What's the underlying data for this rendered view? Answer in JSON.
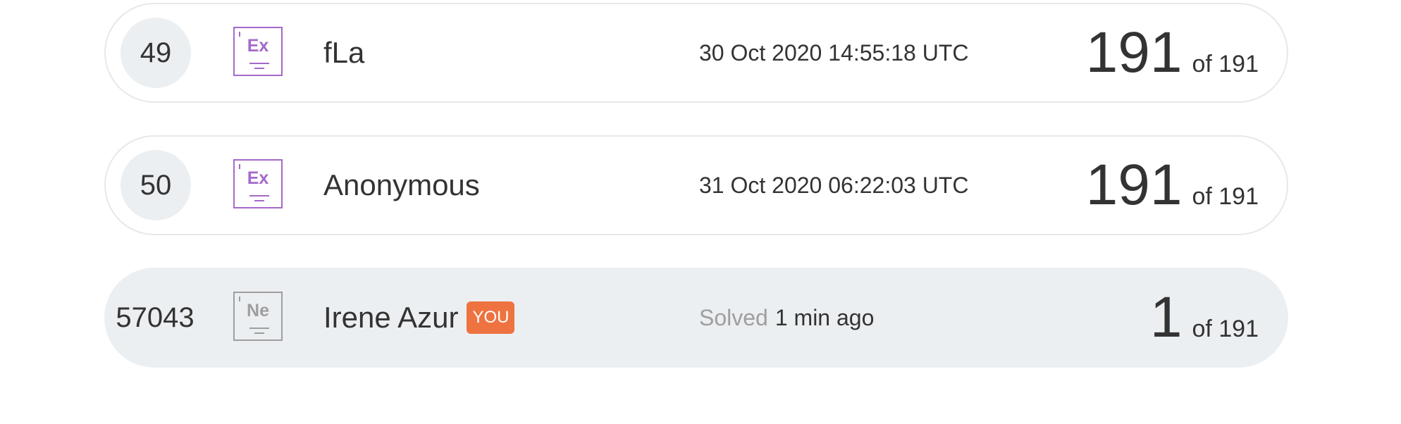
{
  "rows": [
    {
      "rank": "49",
      "level_symbol": "Ex",
      "name": "fLa",
      "time": "30 Oct 2020 14:55:18 UTC",
      "score": "191",
      "total": "of 191"
    },
    {
      "rank": "50",
      "level_symbol": "Ex",
      "name": "Anonymous",
      "time": "31 Oct 2020 06:22:03 UTC",
      "score": "191",
      "total": "of 191"
    },
    {
      "rank": "57043",
      "level_symbol": "Ne",
      "name": "Irene Azur",
      "you_badge": "YOU",
      "solved_label": "Solved",
      "time": "1 min ago",
      "score": "1",
      "total": "of 191"
    }
  ],
  "colors": {
    "expert_level": "#a569c9",
    "newbie_level": "#9e9e9e",
    "you_badge": "#ee7340",
    "current_user_row": "#eceff1"
  },
  "icons": {
    "level_badge": "element-tile-icon"
  }
}
